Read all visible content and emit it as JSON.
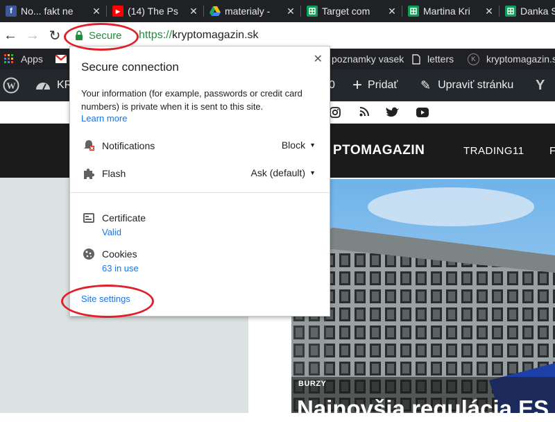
{
  "tabs": [
    {
      "title": "No... fakt ne",
      "icon": "facebook-icon"
    },
    {
      "title": "(14) The Ps",
      "icon": "youtube-icon"
    },
    {
      "title": "materialy -",
      "icon": "google-drive-icon"
    },
    {
      "title": "Target com",
      "icon": "google-sheets-icon"
    },
    {
      "title": "Martina Kri",
      "icon": "google-sheets-icon"
    },
    {
      "title": "Danka S",
      "icon": "google-sheets-icon"
    }
  ],
  "address": {
    "secure_label": "Secure",
    "url_scheme": "https://",
    "url_host": "kryptomagazin.sk"
  },
  "bookmarks": {
    "apps": "Apps",
    "poznamky": "poznamky vasek",
    "letters": "letters",
    "kryptomagazin": "kryptomagazin.s"
  },
  "wpbar": {
    "site": "KR",
    "comments_count": "0",
    "add": "Pridať",
    "edit": "Upraviť stránku"
  },
  "site": {
    "logo": "PTOMAGAZIN",
    "nav_trading": "TRADING11",
    "nav_more": "F"
  },
  "article": {
    "category": "BURZY",
    "headline": "Najnovšia regulácia ES"
  },
  "popup": {
    "title": "Secure connection",
    "description": "Your information (for example, passwords or credit card numbers) is private when it is sent to this site.",
    "learn_more": "Learn more",
    "notifications_label": "Notifications",
    "notifications_value": "Block",
    "flash_label": "Flash",
    "flash_value": "Ask (default)",
    "certificate_label": "Certificate",
    "certificate_value": "Valid",
    "cookies_label": "Cookies",
    "cookies_value": "63 in use",
    "site_settings": "Site settings"
  },
  "colors": {
    "annotation": "#e0202a",
    "secure_green": "#1e8e3e",
    "link_blue": "#1a73e8"
  }
}
